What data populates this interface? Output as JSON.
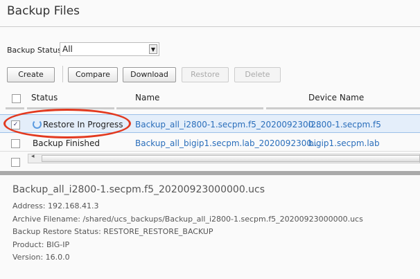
{
  "title": "Backup Files",
  "filter": {
    "label": "Backup Status:",
    "value": "All"
  },
  "toolbar": {
    "create": "Create",
    "compare": "Compare",
    "download": "Download",
    "restore": "Restore",
    "delete": "Delete"
  },
  "columns": {
    "status": "Status",
    "name": "Name",
    "device": "Device Name"
  },
  "rows": [
    {
      "status": "Restore In Progress",
      "name": "Backup_all_i2800-1.secpm.f5_2020092300...",
      "device": "i2800-1.secpm.f5",
      "checked": true
    },
    {
      "status": "Backup Finished",
      "name": "Backup_all_bigip1.secpm.lab_2020092300...",
      "device": "bigip1.secpm.lab",
      "checked": false
    }
  ],
  "detail": {
    "title": "Backup_all_i2800-1.secpm.f5_20200923000000.ucs",
    "lines": [
      "Address: 192.168.41.3",
      "Archive Filename: /shared/ucs_backups/Backup_all_i2800-1.secpm.f5_20200923000000.ucs",
      "Backup Restore Status: RESTORE_RESTORE_BACKUP",
      "Product: BIG-IP",
      "Version: 16.0.0"
    ]
  },
  "colors": {
    "highlight": "#e2391f",
    "link": "#2a6ebb"
  }
}
